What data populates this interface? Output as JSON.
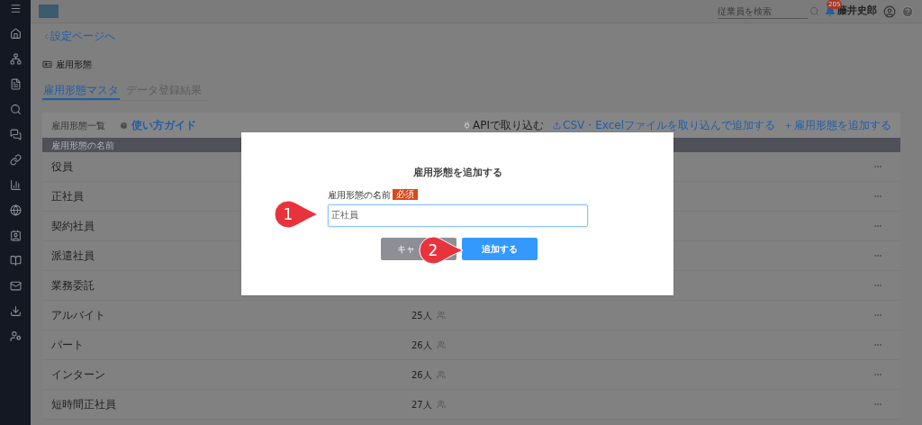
{
  "topbar": {
    "search": {
      "placeholder": "従業員を検索"
    },
    "notification_count": "205",
    "user_name": "藤井史郎"
  },
  "back_link": "設定ページへ",
  "page_title": "雇用形態",
  "tabs": [
    {
      "label": "雇用形態マスタ",
      "selected": true
    },
    {
      "label": "データ登録結果",
      "selected": false
    }
  ],
  "list": {
    "title": "雇用形態一覧",
    "guide_link": "使い方ガイド",
    "actions": [
      {
        "kind": "api",
        "label": "APIで取り込む"
      },
      {
        "kind": "import",
        "label": "CSV・Excelファイルを取り込んで追加する"
      },
      {
        "kind": "add",
        "label": "雇用形態を追加する"
      }
    ],
    "column": "雇用形態の名前",
    "rows": [
      {
        "name": "役員"
      },
      {
        "name": "正社員"
      },
      {
        "name": "契約社員"
      },
      {
        "name": "派遣社員"
      },
      {
        "name": "業務委託"
      },
      {
        "name": "アルバイト",
        "count": "25人"
      },
      {
        "name": "パート",
        "count": "26人"
      },
      {
        "name": "インターン",
        "count": "26人"
      },
      {
        "name": "短時間正社員",
        "count": "27人"
      }
    ]
  },
  "dialog": {
    "title": "雇用形態を追加する",
    "field_label": "雇用形態の名前",
    "required_badge": "必須",
    "value": "正社員",
    "cancel": "キャ",
    "submit": "追加する"
  },
  "callouts": [
    "1",
    "2"
  ]
}
